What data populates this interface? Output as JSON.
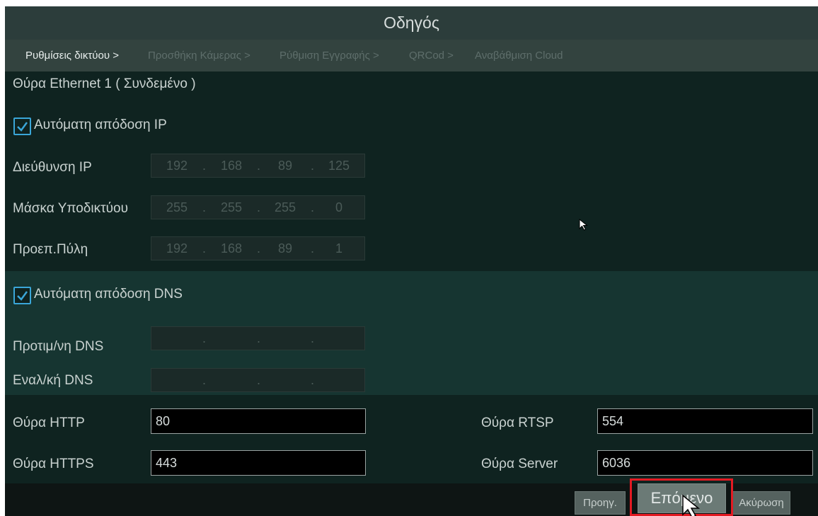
{
  "window": {
    "title": "Οδηγός"
  },
  "breadcrumb": {
    "steps": [
      {
        "label": "Ρυθμίσεις δικτύου >",
        "state": "active"
      },
      {
        "label": "Προσθήκη Κάμερας >",
        "state": "inactive"
      },
      {
        "label": "Ρύθμιση Εγγραφής >",
        "state": "inactive"
      },
      {
        "label": "QRCod >",
        "state": "inactive"
      },
      {
        "label": "Αναβάθμιση Cloud",
        "state": "inactive"
      }
    ]
  },
  "network": {
    "port_title": "Θύρα Ethernet 1 ( Συνδεμένο )",
    "auto_ip": {
      "label": "Αυτόματη απόδοση IP",
      "checked": true
    },
    "ip_address": {
      "label": "Διεύθυνση IP",
      "octets": [
        "192",
        "168",
        "89",
        "125"
      ]
    },
    "subnet_mask": {
      "label": "Μάσκα Υποδικτύου",
      "octets": [
        "255",
        "255",
        "255",
        "0"
      ]
    },
    "gateway": {
      "label": "Προεπ.Πύλη",
      "octets": [
        "192",
        "168",
        "89",
        "1"
      ]
    }
  },
  "dns": {
    "auto_dns": {
      "label": "Αυτόματη απόδοση DNS",
      "checked": true
    },
    "preferred": {
      "label": "Προτιμ/νη DNS",
      "octets": [
        "",
        "",
        "",
        ""
      ]
    },
    "alternate": {
      "label": "Εναλ/κή DNS",
      "octets": [
        "",
        "",
        "",
        ""
      ]
    }
  },
  "ports": {
    "http": {
      "label": "Θύρα HTTP",
      "value": "80"
    },
    "https": {
      "label": "Θύρα HTTPS",
      "value": "443"
    },
    "rtsp": {
      "label": "Θύρα RTSP",
      "value": "554"
    },
    "server": {
      "label": "Θύρα Server",
      "value": "6036"
    }
  },
  "footer": {
    "prev_label": "Προηγ.",
    "next_label": "Επόμενο",
    "cancel_label": "Ακύρωση"
  },
  "colors": {
    "highlight": "#e31b23",
    "checkbox_accent": "#3aa6d8"
  },
  "icons": {
    "checkbox_check": "check-icon",
    "pointer": "mouse-pointer-icon"
  }
}
